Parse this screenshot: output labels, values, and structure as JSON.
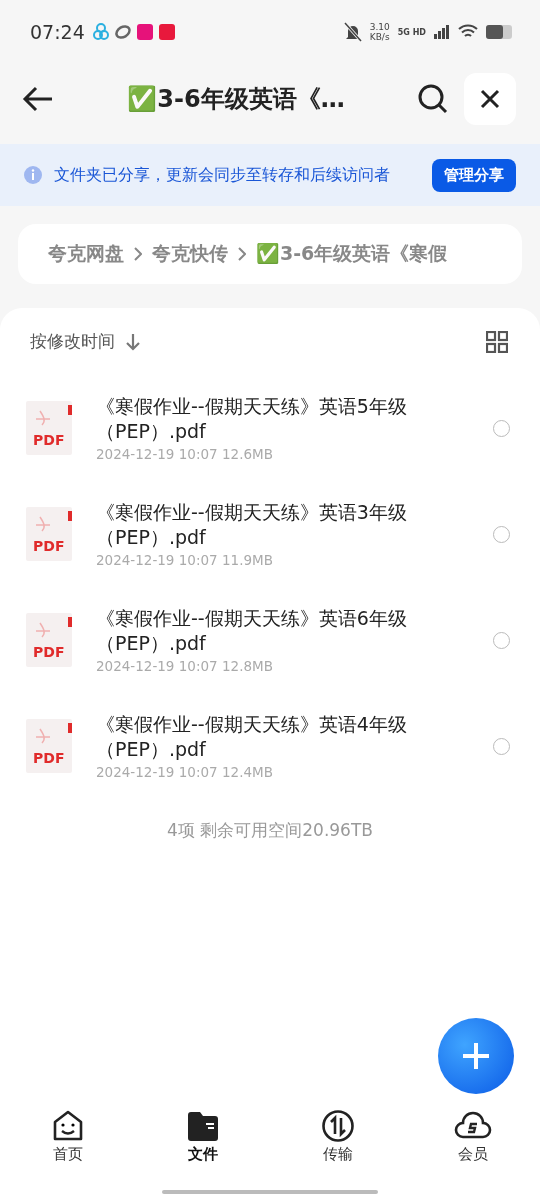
{
  "status_bar": {
    "time": "07:24",
    "net_speed": "3.10",
    "net_unit": "KB/s",
    "network": "5G HD"
  },
  "header": {
    "title": "✅3-6年级英语《…"
  },
  "share_banner": {
    "message": "文件夹已分享，更新会同步至转存和后续访问者",
    "button": "管理分享"
  },
  "breadcrumb": [
    "夸克网盘",
    "夸克快传",
    "✅3-6年级英语《寒假"
  ],
  "sort": {
    "label": "按修改时间"
  },
  "files": [
    {
      "name": "《寒假作业--假期天天练》英语5年级（PEP）.pdf",
      "date": "2024-12-19 10:07",
      "size": "12.6MB",
      "type_label": "PDF",
      "selected": false
    },
    {
      "name": "《寒假作业--假期天天练》英语3年级（PEP）.pdf",
      "date": "2024-12-19 10:07",
      "size": "11.9MB",
      "type_label": "PDF",
      "selected": false
    },
    {
      "name": "《寒假作业--假期天天练》英语6年级（PEP）.pdf",
      "date": "2024-12-19 10:07",
      "size": "12.8MB",
      "type_label": "PDF",
      "selected": false
    },
    {
      "name": "《寒假作业--假期天天练》英语4年级（PEP）.pdf",
      "date": "2024-12-19 10:07",
      "size": "12.4MB",
      "type_label": "PDF",
      "selected": false
    }
  ],
  "footer": "4项 剩余可用空间20.96TB",
  "tabs": [
    {
      "label": "首页",
      "kind": "home",
      "selected": false
    },
    {
      "label": "文件",
      "kind": "files",
      "selected": true
    },
    {
      "label": "传输",
      "kind": "transfer",
      "selected": false
    },
    {
      "label": "会员",
      "kind": "cloud",
      "selected": false
    }
  ]
}
